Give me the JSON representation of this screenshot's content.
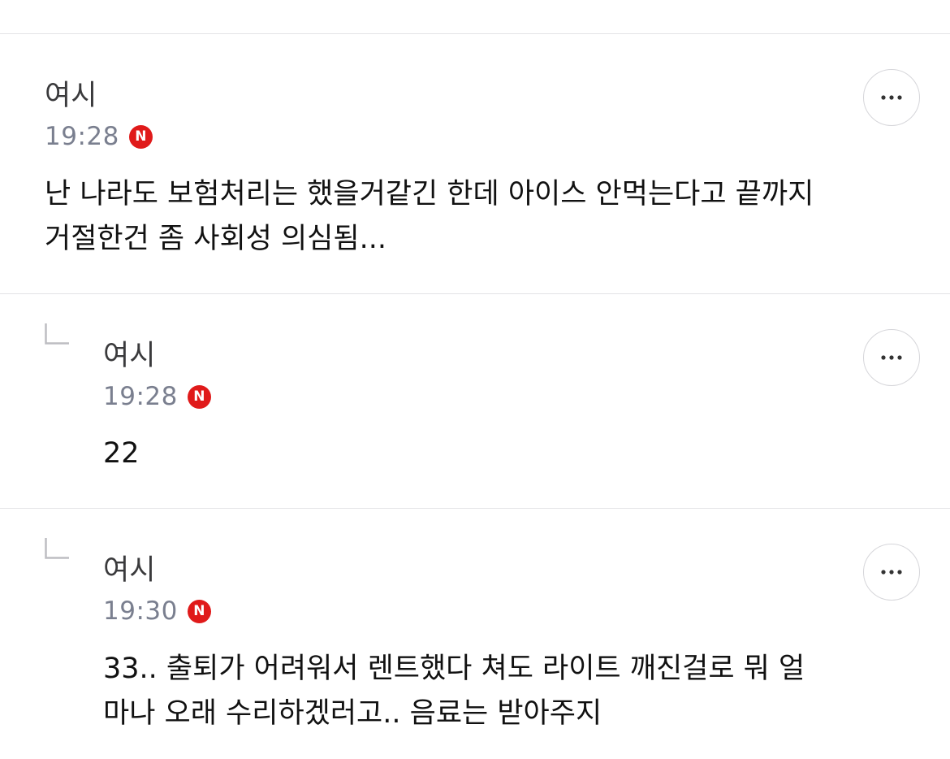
{
  "comments": [
    {
      "author": "여시",
      "time": "19:28",
      "badge": "N",
      "is_reply": false,
      "lines": [
        "난 나라도 보험처리는 했을거같긴 한데 아이스 안먹는다고 끝까지",
        "거절한건 좀 사회성 의심됨..."
      ]
    },
    {
      "author": "여시",
      "time": "19:28",
      "badge": "N",
      "is_reply": true,
      "lines": [
        "22"
      ]
    },
    {
      "author": "여시",
      "time": "19:30",
      "badge": "N",
      "is_reply": true,
      "lines": [
        "33.. 출퇴가 어려워서 렌트했다 쳐도 라이트 깨진걸로 뭐 얼",
        "마나 오래 수리하겠러고.. 음료는 받아주지"
      ]
    }
  ],
  "icons": {
    "more": "more-horizontal-icon",
    "reply": "reply-arrow-icon",
    "badge": "new-badge-icon"
  },
  "colors": {
    "badge": "#e01a1a",
    "time": "#7a7f8f",
    "divider": "#e3e3e6"
  }
}
